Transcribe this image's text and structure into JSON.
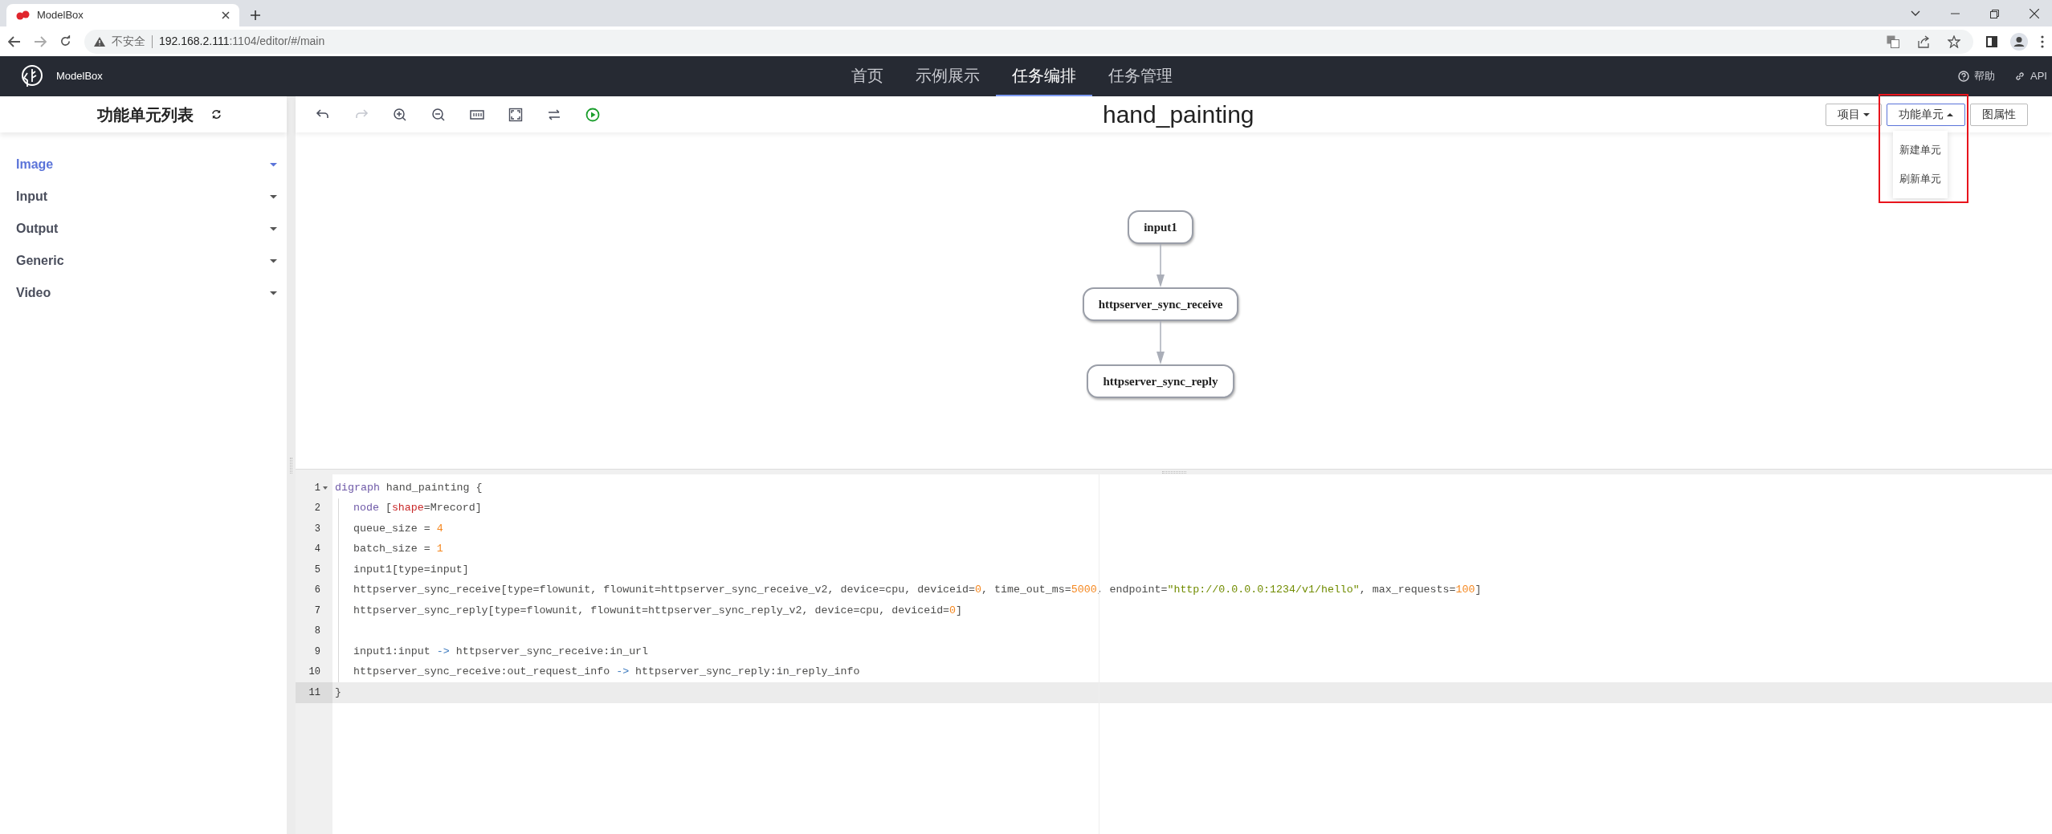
{
  "browser": {
    "tab": {
      "title": "ModelBox"
    },
    "address": {
      "warning": "不安全",
      "host": "192.168.2.111",
      "path": ":1104/editor/#/main"
    }
  },
  "app_header": {
    "brand": "ModelBox",
    "nav": [
      {
        "label": "首页",
        "selected": false
      },
      {
        "label": "示例展示",
        "selected": false
      },
      {
        "label": "任务编排",
        "selected": true
      },
      {
        "label": "任务管理",
        "selected": false
      }
    ],
    "links": [
      {
        "kind": "help",
        "label": "帮助"
      },
      {
        "kind": "link",
        "label": "API"
      }
    ]
  },
  "sidebar": {
    "title": "功能单元列表",
    "items": [
      {
        "label": "Image",
        "selected": true
      },
      {
        "label": "Input",
        "selected": false
      },
      {
        "label": "Output",
        "selected": false
      },
      {
        "label": "Generic",
        "selected": false
      },
      {
        "label": "Video",
        "selected": false
      }
    ]
  },
  "toolbar": {
    "title": "hand_painting",
    "tools": [
      {
        "kind": "undo",
        "disabled": false
      },
      {
        "kind": "redo",
        "disabled": true
      },
      {
        "kind": "zoom-in",
        "disabled": false
      },
      {
        "kind": "zoom-out",
        "disabled": false
      },
      {
        "kind": "fit",
        "disabled": false
      },
      {
        "kind": "fullscreen",
        "disabled": false
      },
      {
        "kind": "swap",
        "disabled": false
      },
      {
        "kind": "run",
        "disabled": false
      }
    ],
    "buttons": [
      {
        "label": "项目",
        "kind": "dropdown",
        "expanded": false,
        "highlighted": false
      },
      {
        "label": "功能单元",
        "kind": "dropdown",
        "expanded": true,
        "highlighted": true
      },
      {
        "label": "图属性",
        "kind": "plain",
        "expanded": false,
        "highlighted": false
      }
    ],
    "menu": [
      "新建单元",
      "刷新单元"
    ]
  },
  "graph": {
    "nodes": [
      {
        "label": "input1"
      },
      {
        "label": "httpserver_sync_receive"
      },
      {
        "label": "httpserver_sync_reply"
      }
    ]
  },
  "editor": {
    "lines": [
      {
        "number": "1",
        "fold": true,
        "indent": false,
        "active": false,
        "tokens": [
          {
            "kind": "kw",
            "t": "digraph"
          },
          {
            "kind": "plain",
            "t": " hand_painting "
          },
          {
            "kind": "plain",
            "t": "{"
          }
        ]
      },
      {
        "number": "2",
        "fold": false,
        "indent": true,
        "active": false,
        "tokens": [
          {
            "kind": "kw",
            "t": "node"
          },
          {
            "kind": "plain",
            "t": " ["
          },
          {
            "kind": "attr",
            "t": "shape"
          },
          {
            "kind": "plain",
            "t": "=Mrecord]"
          }
        ]
      },
      {
        "number": "3",
        "fold": false,
        "indent": true,
        "active": false,
        "tokens": [
          {
            "kind": "plain",
            "t": "queue_size = "
          },
          {
            "kind": "num",
            "t": "4"
          }
        ]
      },
      {
        "number": "4",
        "fold": false,
        "indent": true,
        "active": false,
        "tokens": [
          {
            "kind": "plain",
            "t": "batch_size = "
          },
          {
            "kind": "num",
            "t": "1"
          }
        ]
      },
      {
        "number": "5",
        "fold": false,
        "indent": true,
        "active": false,
        "tokens": [
          {
            "kind": "plain",
            "t": "input1[type=input]"
          }
        ]
      },
      {
        "number": "6",
        "fold": false,
        "indent": true,
        "active": false,
        "tokens": [
          {
            "kind": "plain",
            "t": "httpserver_sync_receive[type=flowunit, flowunit=httpserver_sync_receive_v2, device=cpu, deviceid="
          },
          {
            "kind": "num",
            "t": "0"
          },
          {
            "kind": "plain",
            "t": ", time_out_ms="
          },
          {
            "kind": "num",
            "t": "5000"
          },
          {
            "kind": "plain",
            "t": ", endpoint="
          },
          {
            "kind": "str",
            "t": "\"http://0.0.0.0:1234/v1/hello\""
          },
          {
            "kind": "plain",
            "t": ", max_requests="
          },
          {
            "kind": "num",
            "t": "100"
          },
          {
            "kind": "plain",
            "t": "]"
          }
        ]
      },
      {
        "number": "7",
        "fold": false,
        "indent": true,
        "active": false,
        "tokens": [
          {
            "kind": "plain",
            "t": "httpserver_sync_reply[type=flowunit, flowunit=httpserver_sync_reply_v2, device=cpu, deviceid="
          },
          {
            "kind": "num",
            "t": "0"
          },
          {
            "kind": "plain",
            "t": "]"
          }
        ]
      },
      {
        "number": "8",
        "fold": false,
        "indent": true,
        "active": false
      },
      {
        "number": "9",
        "fold": false,
        "indent": true,
        "active": false,
        "tokens": [
          {
            "kind": "plain",
            "t": "input1:input "
          },
          {
            "kind": "op",
            "t": "->"
          },
          {
            "kind": "plain",
            "t": " httpserver_sync_receive:in_url"
          }
        ]
      },
      {
        "number": "10",
        "fold": false,
        "indent": true,
        "active": false,
        "tokens": [
          {
            "kind": "plain",
            "t": "httpserver_sync_receive:out_request_info "
          },
          {
            "kind": "op",
            "t": "->"
          },
          {
            "kind": "plain",
            "t": " httpserver_sync_reply:in_reply_info"
          }
        ]
      },
      {
        "number": "11",
        "fold": false,
        "indent": false,
        "active": true,
        "tokens": [
          {
            "kind": "plain",
            "t": "}"
          }
        ]
      }
    ]
  }
}
